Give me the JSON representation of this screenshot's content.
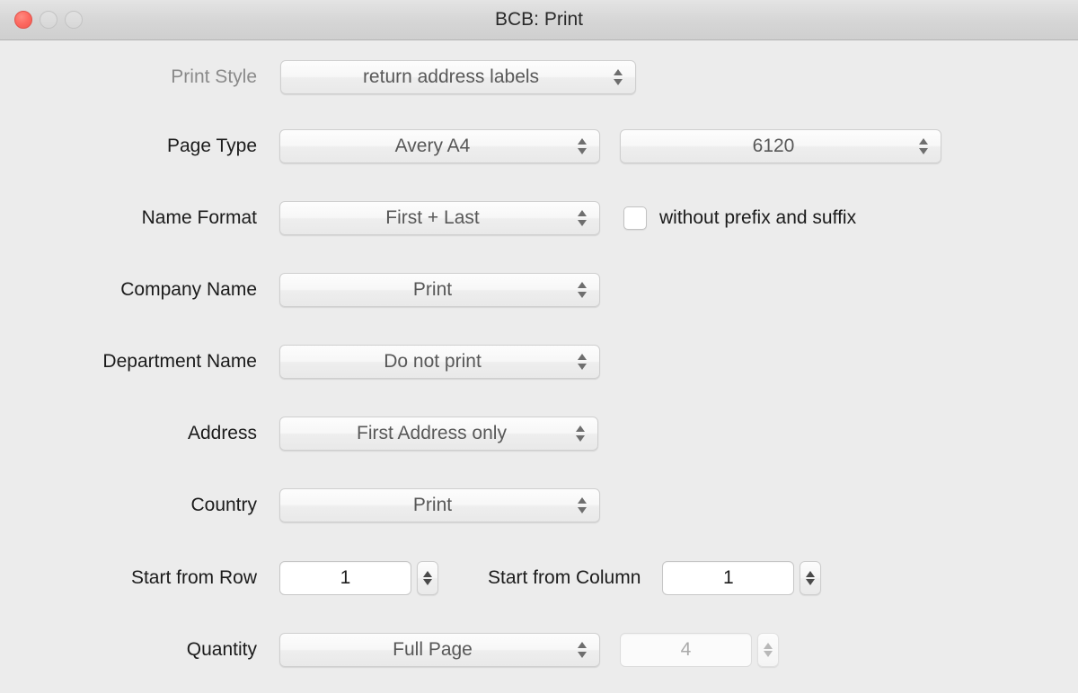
{
  "window": {
    "title": "BCB: Print",
    "controls": {
      "close": "close-button",
      "minimize": "minimize-button",
      "zoom": "zoom-button"
    }
  },
  "form": {
    "print_style": {
      "label": "Print Style",
      "value": "return address labels"
    },
    "page_type": {
      "label": "Page Type",
      "value": "Avery A4",
      "value2": "6120"
    },
    "name_format": {
      "label": "Name Format",
      "value": "First + Last",
      "checkbox_label": "without prefix and suffix",
      "checkbox_checked": false
    },
    "company_name": {
      "label": "Company Name",
      "value": "Print"
    },
    "department_name": {
      "label": "Department Name",
      "value": "Do not print"
    },
    "address": {
      "label": "Address",
      "value": "First Address only"
    },
    "country": {
      "label": "Country",
      "value": "Print"
    },
    "start_from_row": {
      "label": "Start from Row",
      "value": "1"
    },
    "start_from_column": {
      "label": "Start from Column",
      "value": "1"
    },
    "quantity": {
      "label": "Quantity",
      "value": "Full Page",
      "count_value": "4",
      "count_enabled": false
    }
  },
  "colors": {
    "background": "#ececec",
    "titlebar": "#d8d8d8",
    "close_button": "#fd6a61",
    "label_text": "#1b1b1b",
    "dim_label_text": "#8a8a8a",
    "popup_value_text": "#585858"
  }
}
